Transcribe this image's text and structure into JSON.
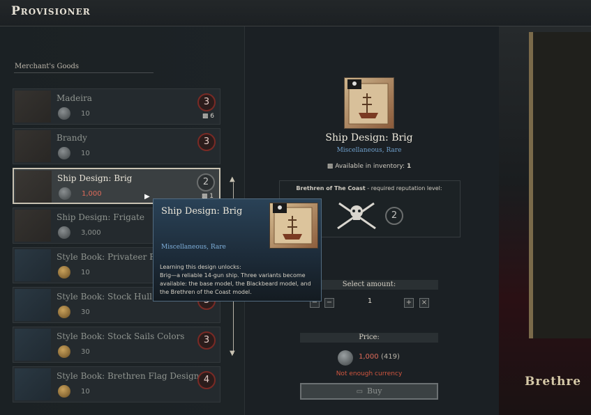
{
  "header": {
    "title": "Provisioner"
  },
  "list": {
    "section_label": "Merchant's Goods",
    "items": [
      {
        "name": "Madeira",
        "price": "10",
        "rep": "3",
        "inventory": "6",
        "currency": "silver",
        "thumb": "bottle-icon"
      },
      {
        "name": "Brandy",
        "price": "10",
        "rep": "3",
        "inventory": "",
        "currency": "silver",
        "thumb": "barrel-icon"
      },
      {
        "name": "Ship Design: Brig",
        "price": "1,000",
        "rep": "2",
        "inventory": "1",
        "currency": "silver",
        "thumb": "blueprint-icon",
        "selected": true
      },
      {
        "name": "Ship Design: Frigate",
        "price": "3,000",
        "rep": "",
        "inventory": "",
        "currency": "silver",
        "thumb": "blueprint-icon"
      },
      {
        "name": "Style Book: Privateer Fla",
        "price": "10",
        "rep": "",
        "inventory": "",
        "currency": "gold",
        "thumb": "book-icon"
      },
      {
        "name": "Style Book: Stock Hull C",
        "price": "30",
        "rep": "3",
        "inventory": "",
        "currency": "gold",
        "thumb": "book-icon"
      },
      {
        "name": "Style Book: Stock Sails Colors",
        "price": "30",
        "rep": "3",
        "inventory": "",
        "currency": "gold",
        "thumb": "book-icon"
      },
      {
        "name": "Style Book: Brethren Flag Designs",
        "price": "10",
        "rep": "4",
        "inventory": "",
        "currency": "gold",
        "thumb": "book-icon"
      }
    ]
  },
  "detail": {
    "name": "Ship Design: Brig",
    "subtitle": "Miscellaneous, Rare",
    "available_label": "Available in inventory: ",
    "available_count": "1",
    "faction": "Brethren of The Coast",
    "rep_label": " - required reputation level:",
    "rep_level": "2",
    "select_amount": "Select amount:",
    "quantity": "1",
    "price_label": "Price:",
    "price_value": "1,000",
    "price_owned": "(419)",
    "not_enough": "Not enough currency",
    "buy_label": "Buy"
  },
  "tooltip": {
    "name": "Ship Design: Brig",
    "subtitle": "Miscellaneous, Rare",
    "description_1": "Learning this design unlocks:",
    "description_2": "Brig—a reliable 14-gun ship. Three variants become available: the base model, the Blackbeard model, and the Brethren of the Coast model."
  },
  "art": {
    "banner": "Brethre"
  },
  "colors": {
    "accent_red": "#e06b5a",
    "rarity_blue": "#6fa0cc",
    "warning": "#d2563f"
  }
}
